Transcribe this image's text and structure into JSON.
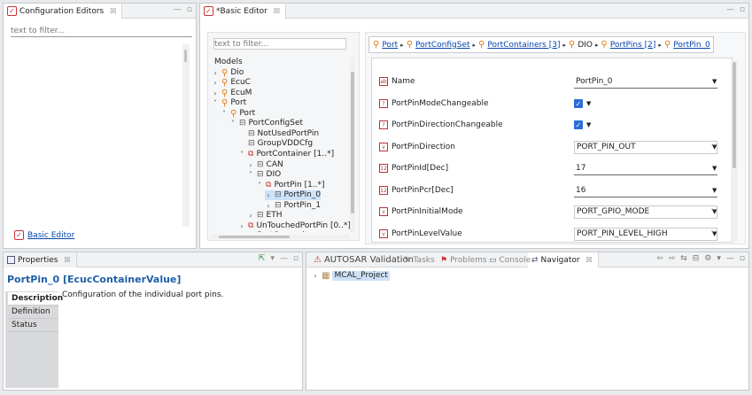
{
  "config_editors": {
    "tab_label": "Configuration Editors",
    "filter_placeholder": "text to filter...",
    "basic_editor_link": "Basic Editor"
  },
  "basic_editor": {
    "tab_label": "*Basic Editor",
    "filter_placeholder": "text to filter...",
    "tree": [
      {
        "label": "Models",
        "twisty": "",
        "icon": ""
      },
      {
        "label": "Dio",
        "twisty": ">",
        "icon": "fork"
      },
      {
        "label": "EcuC",
        "twisty": ">",
        "icon": "fork"
      },
      {
        "label": "EcuM",
        "twisty": ">",
        "icon": "fork"
      },
      {
        "label": "Port",
        "twisty": "v",
        "icon": "fork"
      },
      {
        "label": "Port",
        "twisty": "v",
        "icon": "fork"
      },
      {
        "label": "PortConfigSet",
        "twisty": "v",
        "icon": "box"
      },
      {
        "label": "NotUsedPortPin",
        "twisty": "",
        "icon": "box"
      },
      {
        "label": "GroupVDDCfg",
        "twisty": "",
        "icon": "box"
      },
      {
        "label": "PortContainer [1..*]",
        "twisty": "v",
        "icon": "multi"
      },
      {
        "label": "CAN",
        "twisty": ">",
        "icon": "box"
      },
      {
        "label": "DIO",
        "twisty": "v",
        "icon": "box"
      },
      {
        "label": "PortPin [1..*]",
        "twisty": "v",
        "icon": "multi"
      },
      {
        "label": "PortPin_0",
        "twisty": ">",
        "icon": "box"
      },
      {
        "label": "PortPin_1",
        "twisty": ">",
        "icon": "box"
      },
      {
        "label": "ETH",
        "twisty": ">",
        "icon": "box"
      },
      {
        "label": "UnTouchedPortPin [0..*]",
        "twisty": ">",
        "icon": "multi"
      },
      {
        "label": "PortGeneral",
        "twisty": "",
        "icon": "box"
      }
    ],
    "breadcrumb": [
      {
        "label": "Port",
        "link": true
      },
      {
        "label": "PortConfigSet",
        "link": true
      },
      {
        "label": "PortContainers [3]",
        "link": true
      },
      {
        "label": "DIO",
        "link": false
      },
      {
        "label": "PortPins [2]",
        "link": true
      },
      {
        "label": "PortPin_0",
        "link": true
      }
    ],
    "params": [
      {
        "name": "Name",
        "type": "text",
        "value": "PortPin_0",
        "icon": "ab"
      },
      {
        "name": "PortPinModeChangeable",
        "type": "check",
        "value": "",
        "icon": "?"
      },
      {
        "name": "PortPinDirectionChangeable",
        "type": "check",
        "value": "",
        "icon": "?"
      },
      {
        "name": "PortPinDirection",
        "type": "combo",
        "value": "PORT_PIN_OUT",
        "icon": "v"
      },
      {
        "name": "PortPinId[Dec]",
        "type": "text",
        "value": "17",
        "icon": "12"
      },
      {
        "name": "PortPinPcr[Dec]",
        "type": "text",
        "value": "16",
        "icon": "12"
      },
      {
        "name": "PortPinInitialMode",
        "type": "combo",
        "value": "PORT_GPIO_MODE",
        "icon": "v"
      },
      {
        "name": "PortPinLevelValue",
        "type": "combo",
        "value": "PORT_PIN_LEVEL_HIGH",
        "icon": "v"
      }
    ]
  },
  "properties": {
    "tab_label": "Properties",
    "title": "PortPin_0 [EcucContainerValue]",
    "description": "Configuration of the individual port pins.",
    "side_tabs": [
      "Description",
      "Definition",
      "Status"
    ]
  },
  "bottom_views": {
    "tabs": [
      "AUTOSAR Validation",
      "Tasks",
      "Problems",
      "Console",
      "Navigator"
    ],
    "project": "MCAL_Project"
  }
}
